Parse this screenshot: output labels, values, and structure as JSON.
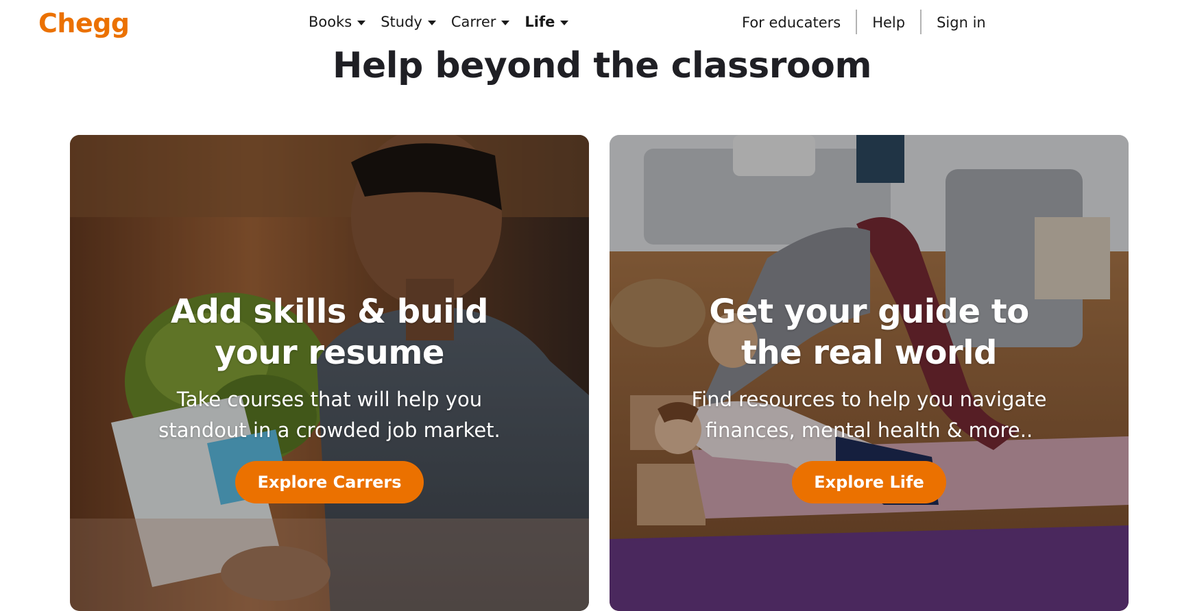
{
  "header": {
    "logo": "Chegg",
    "nav": [
      {
        "label": "Books"
      },
      {
        "label": "Study"
      },
      {
        "label": "Carrer"
      },
      {
        "label": "Life"
      }
    ],
    "links": {
      "educators": "For educaters",
      "help": "Help",
      "signin": "Sign in"
    }
  },
  "main": {
    "headline": "Help beyond the classroom",
    "cards": [
      {
        "title_line1": "Add skills & build",
        "title_line2": "your resume",
        "desc": "Take courses that will help you standout in a crowded job market.",
        "button": "Explore Carrers"
      },
      {
        "title_line1": "Get your guide to",
        "title_line2": "the real world",
        "desc": "Find resources to help you navigate finances, mental health & more..",
        "button": "Explore Life"
      }
    ]
  },
  "colors": {
    "brand": "#eb7100",
    "text": "#1f1f24"
  }
}
